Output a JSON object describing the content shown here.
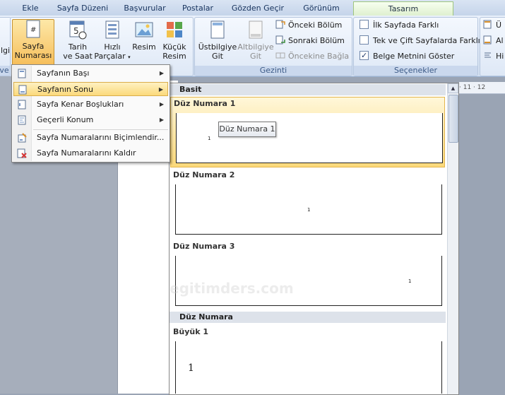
{
  "tabs": [
    {
      "label": "Ekle"
    },
    {
      "label": "Sayfa Düzeni"
    },
    {
      "label": "Başvurular"
    },
    {
      "label": "Postalar"
    },
    {
      "label": "Gözden Geçir"
    },
    {
      "label": "Görünüm"
    },
    {
      "label": "Tasarım"
    }
  ],
  "ribbon": {
    "cut_left_label": "lgi",
    "cut_left_label2": "ve A",
    "page_number_label": "Sayfa",
    "page_number_label2": "Numarası",
    "date_time_label": "Tarih",
    "date_time_label2": "ve Saat",
    "quick_parts_label": "Hızlı",
    "quick_parts_label2": "Parçalar",
    "picture_label": "Resim",
    "clipart_label": "Küçük",
    "clipart_label2": "Resim",
    "header_label": "Üstbilgiye",
    "header_label2": "Git",
    "footer_label": "Altbilgiye",
    "footer_label2": "Git",
    "prev_section": "Önceki Bölüm",
    "next_section": "Sonraki Bölüm",
    "link_previous": "Öncekine Bağla",
    "navigation_group": "Gezinti",
    "first_page_diff": "İlk Sayfada Farklı",
    "odd_even_diff": "Tek ve Çift Sayfalarda Farklı",
    "show_doc_text": "Belge Metnini Göster",
    "options_group": "Seçenekler",
    "right_cut_1": "Ü",
    "right_cut_2": "Al",
    "right_cut_3": "Hi"
  },
  "menu": {
    "items": [
      {
        "label": "Sayfanın Başı",
        "has_submenu": true
      },
      {
        "label": "Sayfanın Sonu",
        "has_submenu": true
      },
      {
        "label": "Sayfa Kenar Boşlukları",
        "has_submenu": true
      },
      {
        "label": "Geçerli Konum",
        "has_submenu": true
      },
      {
        "label": "Sayfa Numaralarını Biçimlendir...",
        "has_submenu": false
      },
      {
        "label": "Sayfa Numaralarını Kaldır",
        "has_submenu": false
      }
    ]
  },
  "gallery": {
    "section_basit": "Basit",
    "item1_title": "Düz Numara 1",
    "item2_title": "Düz Numara 2",
    "item3_title": "Düz Numara 3",
    "section_duz": "Düz Numara",
    "item4_title": "Büyük 1",
    "page_num": "1",
    "page_num_big": "1",
    "tooltip": "Düz Numara 1"
  },
  "ruler": {
    "text": "· 11 · 12"
  },
  "watermark": "egitimders.com",
  "colors": {
    "accent_tab": "#dff0cf",
    "highlight": "#fbd97b",
    "ribbon": "#d3e0f1"
  }
}
